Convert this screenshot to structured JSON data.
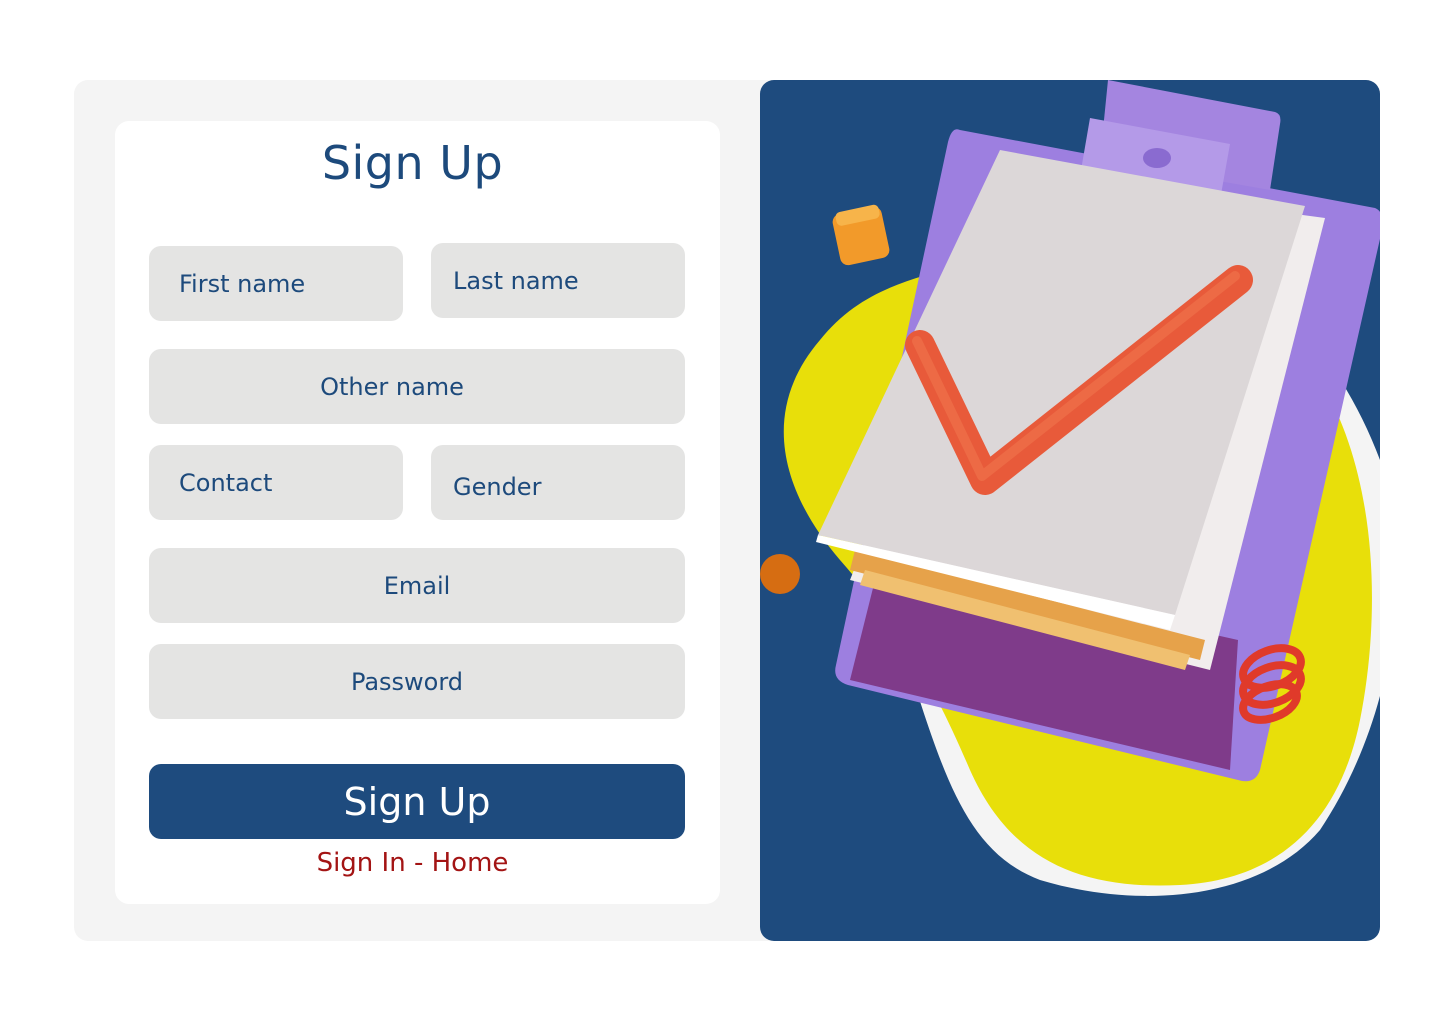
{
  "form": {
    "title": "Sign Up",
    "fields": {
      "first_name": {
        "placeholder": "First name"
      },
      "last_name": {
        "placeholder": "Last name"
      },
      "other_name": {
        "placeholder": "Other name"
      },
      "contact": {
        "placeholder": "Contact"
      },
      "gender": {
        "placeholder": "Gender"
      },
      "email": {
        "placeholder": "Email"
      },
      "password": {
        "placeholder": "Password"
      }
    },
    "submit_label": "Sign Up",
    "links": {
      "sign_in": "Sign In",
      "separator": "-",
      "home": "Home"
    }
  },
  "colors": {
    "brand": "#1e4b7e",
    "link": "#a31414",
    "field_bg": "#e4e4e3",
    "accent_yellow": "#e8df0a",
    "accent_purple": "#9c7fde"
  },
  "illustration": {
    "icon": "clipboard-checkmark-illustration"
  }
}
